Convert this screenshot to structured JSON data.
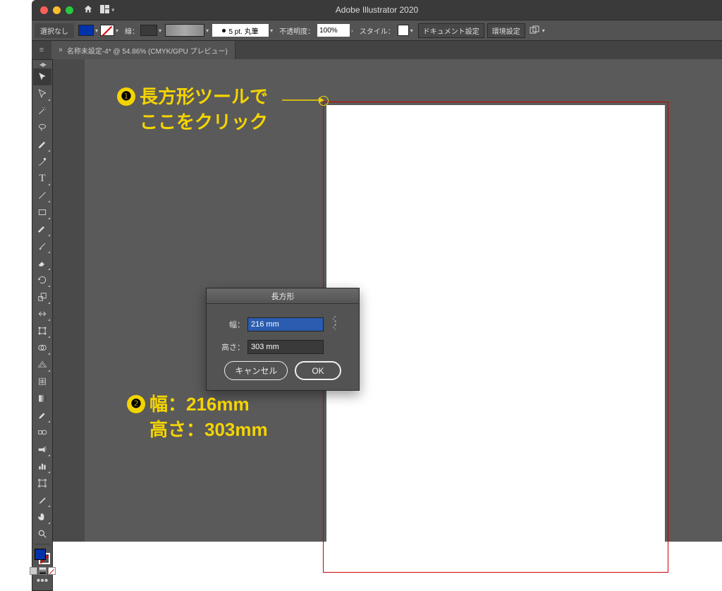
{
  "app": {
    "title": "Adobe Illustrator 2020"
  },
  "optionsBar": {
    "selectionNone": "選択なし",
    "strokeLabel": "線：",
    "brush": "5 pt. 丸筆",
    "opacityLabel": "不透明度：",
    "opacityValue": "100%",
    "styleLabel": "スタイル：",
    "docSetup": "ドキュメント設定",
    "prefs": "環境設定"
  },
  "docTab": {
    "name": "名称未設定-4* @ 54.86% (CMYK/GPU プレビュー)"
  },
  "dialog": {
    "title": "長方形",
    "widthLabel": "幅：",
    "widthValue": "216 mm",
    "heightLabel": "高さ：",
    "heightValue": "303 mm",
    "cancel": "キャンセル",
    "ok": "OK"
  },
  "annotations": {
    "n1": "❶",
    "line1a": "長方形ツールで",
    "line1b": "ここをクリック",
    "n2": "❷",
    "line2a": "幅：216mm",
    "line2b": "高さ：303mm"
  }
}
